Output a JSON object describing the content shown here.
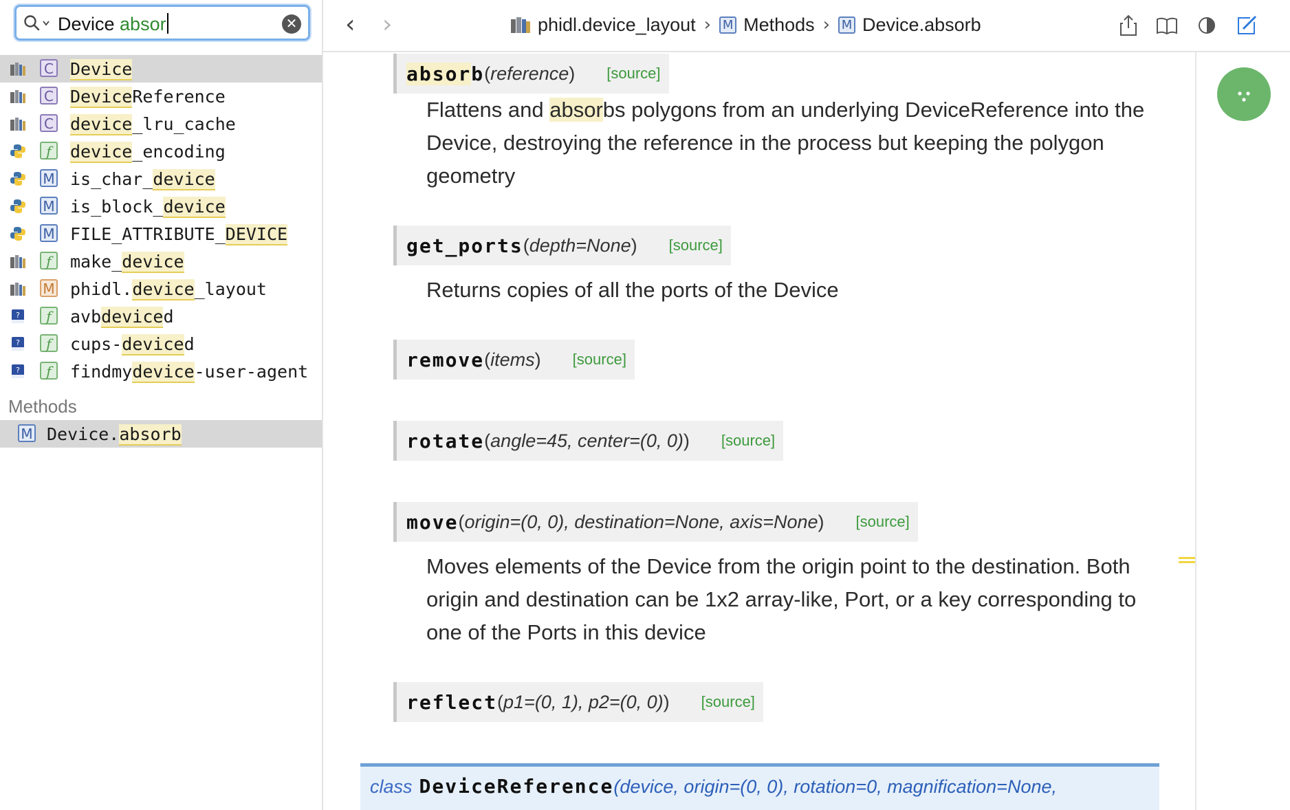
{
  "search": {
    "text_plain": "Device ",
    "text_typed": "absor"
  },
  "results": [
    {
      "badge": "C",
      "parts": [
        {
          "t": "Device",
          "h": true
        }
      ],
      "lib": "book"
    },
    {
      "badge": "C",
      "parts": [
        {
          "t": "Device",
          "h": true
        },
        {
          "t": "Reference",
          "h": false
        }
      ],
      "lib": "book"
    },
    {
      "badge": "C",
      "parts": [
        {
          "t": "device",
          "h": true
        },
        {
          "t": "_lru_cache",
          "h": false
        }
      ],
      "lib": "book"
    },
    {
      "badge": "f",
      "parts": [
        {
          "t": "device",
          "h": true
        },
        {
          "t": "_encoding",
          "h": false
        }
      ],
      "lib": "python"
    },
    {
      "badge": "M",
      "parts": [
        {
          "t": "is_char_",
          "h": false
        },
        {
          "t": "device",
          "h": true
        }
      ],
      "lib": "python"
    },
    {
      "badge": "M",
      "parts": [
        {
          "t": "is_block_",
          "h": false
        },
        {
          "t": "device",
          "h": true
        }
      ],
      "lib": "python"
    },
    {
      "badge": "M",
      "parts": [
        {
          "t": "FILE_ATTRIBUTE_",
          "h": false
        },
        {
          "t": "DEVICE",
          "h": true
        }
      ],
      "lib": "python"
    },
    {
      "badge": "f",
      "parts": [
        {
          "t": "make_",
          "h": false
        },
        {
          "t": "device",
          "h": true
        }
      ],
      "lib": "book"
    },
    {
      "badge": "M",
      "orange": true,
      "parts": [
        {
          "t": "phidl.",
          "h": false
        },
        {
          "t": "device",
          "h": true
        },
        {
          "t": "_layout",
          "h": false
        }
      ],
      "lib": "book"
    },
    {
      "badge": "f",
      "parts": [
        {
          "t": "avb",
          "h": false
        },
        {
          "t": "device",
          "h": true
        },
        {
          "t": "d",
          "h": false
        }
      ],
      "lib": "manual"
    },
    {
      "badge": "f",
      "parts": [
        {
          "t": "cups-",
          "h": false
        },
        {
          "t": "device",
          "h": true
        },
        {
          "t": "d",
          "h": false
        }
      ],
      "lib": "manual"
    },
    {
      "badge": "f",
      "parts": [
        {
          "t": "findmy",
          "h": false
        },
        {
          "t": "device",
          "h": true
        },
        {
          "t": "-user-agent",
          "h": false
        }
      ],
      "lib": "manual"
    }
  ],
  "methods_section": {
    "title": "Methods",
    "item_prefix": "Device.",
    "item_highlight": "absorb",
    "badge": "M"
  },
  "nav": {
    "back": "‹",
    "forward": "›"
  },
  "breadcrumb": {
    "part1": "phidl.device_layout",
    "part2": "Methods",
    "part3": "Device.absorb",
    "separator": "›",
    "badge": "M"
  },
  "docs": {
    "absorb": {
      "name": "absorb",
      "params": "reference",
      "source": "[source]",
      "desc_pre": "Flattens and ",
      "desc_hl": "absor",
      "desc_post": "bs polygons from an underlying DeviceReference into the Device, destroying the reference in the process but keeping the polygon geometry"
    },
    "get_ports": {
      "name": "get_ports",
      "params": "depth=None",
      "source": "[source]",
      "desc": "Returns copies of all the ports of the Device"
    },
    "remove": {
      "name": "remove",
      "params": "items",
      "source": "[source]"
    },
    "rotate": {
      "name": "rotate",
      "params": "angle=45, center=(0, 0)",
      "source": "[source]"
    },
    "move": {
      "name": "move",
      "params": "origin=(0, 0), destination=None, axis=None",
      "source": "[source]",
      "desc": "Moves elements of the Device from the origin point to the destination. Both origin and destination can be 1x2 array-like, Port, or a key corresponding to one of the Ports in this device"
    },
    "reflect": {
      "name": "reflect",
      "params": "p1=(0, 1), p2=(0, 0)",
      "source": "[source]"
    },
    "class_ref": {
      "keyword": "class",
      "name": "DeviceReference",
      "params": "(device, origin=(0, 0), rotation=0, magnification=None,"
    }
  },
  "colors": {
    "accent": "#3c9a3c",
    "float_button": "#6cb66c",
    "search_focus": "#7ab0ea"
  }
}
